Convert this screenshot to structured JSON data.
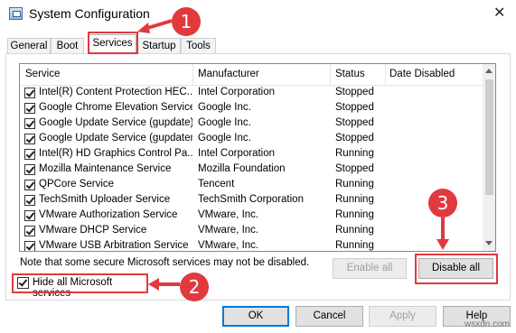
{
  "window": {
    "title": "System Configuration",
    "close_glyph": "✕"
  },
  "tabs": [
    {
      "label": "General"
    },
    {
      "label": "Boot"
    },
    {
      "label": "Services"
    },
    {
      "label": "Startup"
    },
    {
      "label": "Tools"
    }
  ],
  "services": {
    "columns": [
      "Service",
      "Manufacturer",
      "Status",
      "Date Disabled"
    ],
    "rows": [
      {
        "service": "Intel(R) Content Protection HEC...",
        "manufacturer": "Intel Corporation",
        "status": "Stopped"
      },
      {
        "service": "Google Chrome Elevation Service",
        "manufacturer": "Google Inc.",
        "status": "Stopped"
      },
      {
        "service": "Google Update Service (gupdate)",
        "manufacturer": "Google Inc.",
        "status": "Stopped"
      },
      {
        "service": "Google Update Service (gupdatem)",
        "manufacturer": "Google Inc.",
        "status": "Stopped"
      },
      {
        "service": "Intel(R) HD Graphics Control Pa...",
        "manufacturer": "Intel Corporation",
        "status": "Running"
      },
      {
        "service": "Mozilla Maintenance Service",
        "manufacturer": "Mozilla Foundation",
        "status": "Stopped"
      },
      {
        "service": "QPCore Service",
        "manufacturer": "Tencent",
        "status": "Running"
      },
      {
        "service": "TechSmith Uploader Service",
        "manufacturer": "TechSmith Corporation",
        "status": "Running"
      },
      {
        "service": "VMware Authorization Service",
        "manufacturer": "VMware, Inc.",
        "status": "Running"
      },
      {
        "service": "VMware DHCP Service",
        "manufacturer": "VMware, Inc.",
        "status": "Running"
      },
      {
        "service": "VMware USB Arbitration Service",
        "manufacturer": "VMware, Inc.",
        "status": "Running"
      }
    ]
  },
  "note": "Note that some secure Microsoft services may not be disabled.",
  "buttons": {
    "enable_all": "Enable all",
    "disable_all": "Disable all",
    "ok": "OK",
    "cancel": "Cancel",
    "apply": "Apply",
    "help": "Help"
  },
  "hide_ms_label": "Hide all Microsoft services",
  "annotations": {
    "step1": "1",
    "step2": "2",
    "step3": "3",
    "color": "#e0393e"
  },
  "watermark": "wsxdn.com"
}
